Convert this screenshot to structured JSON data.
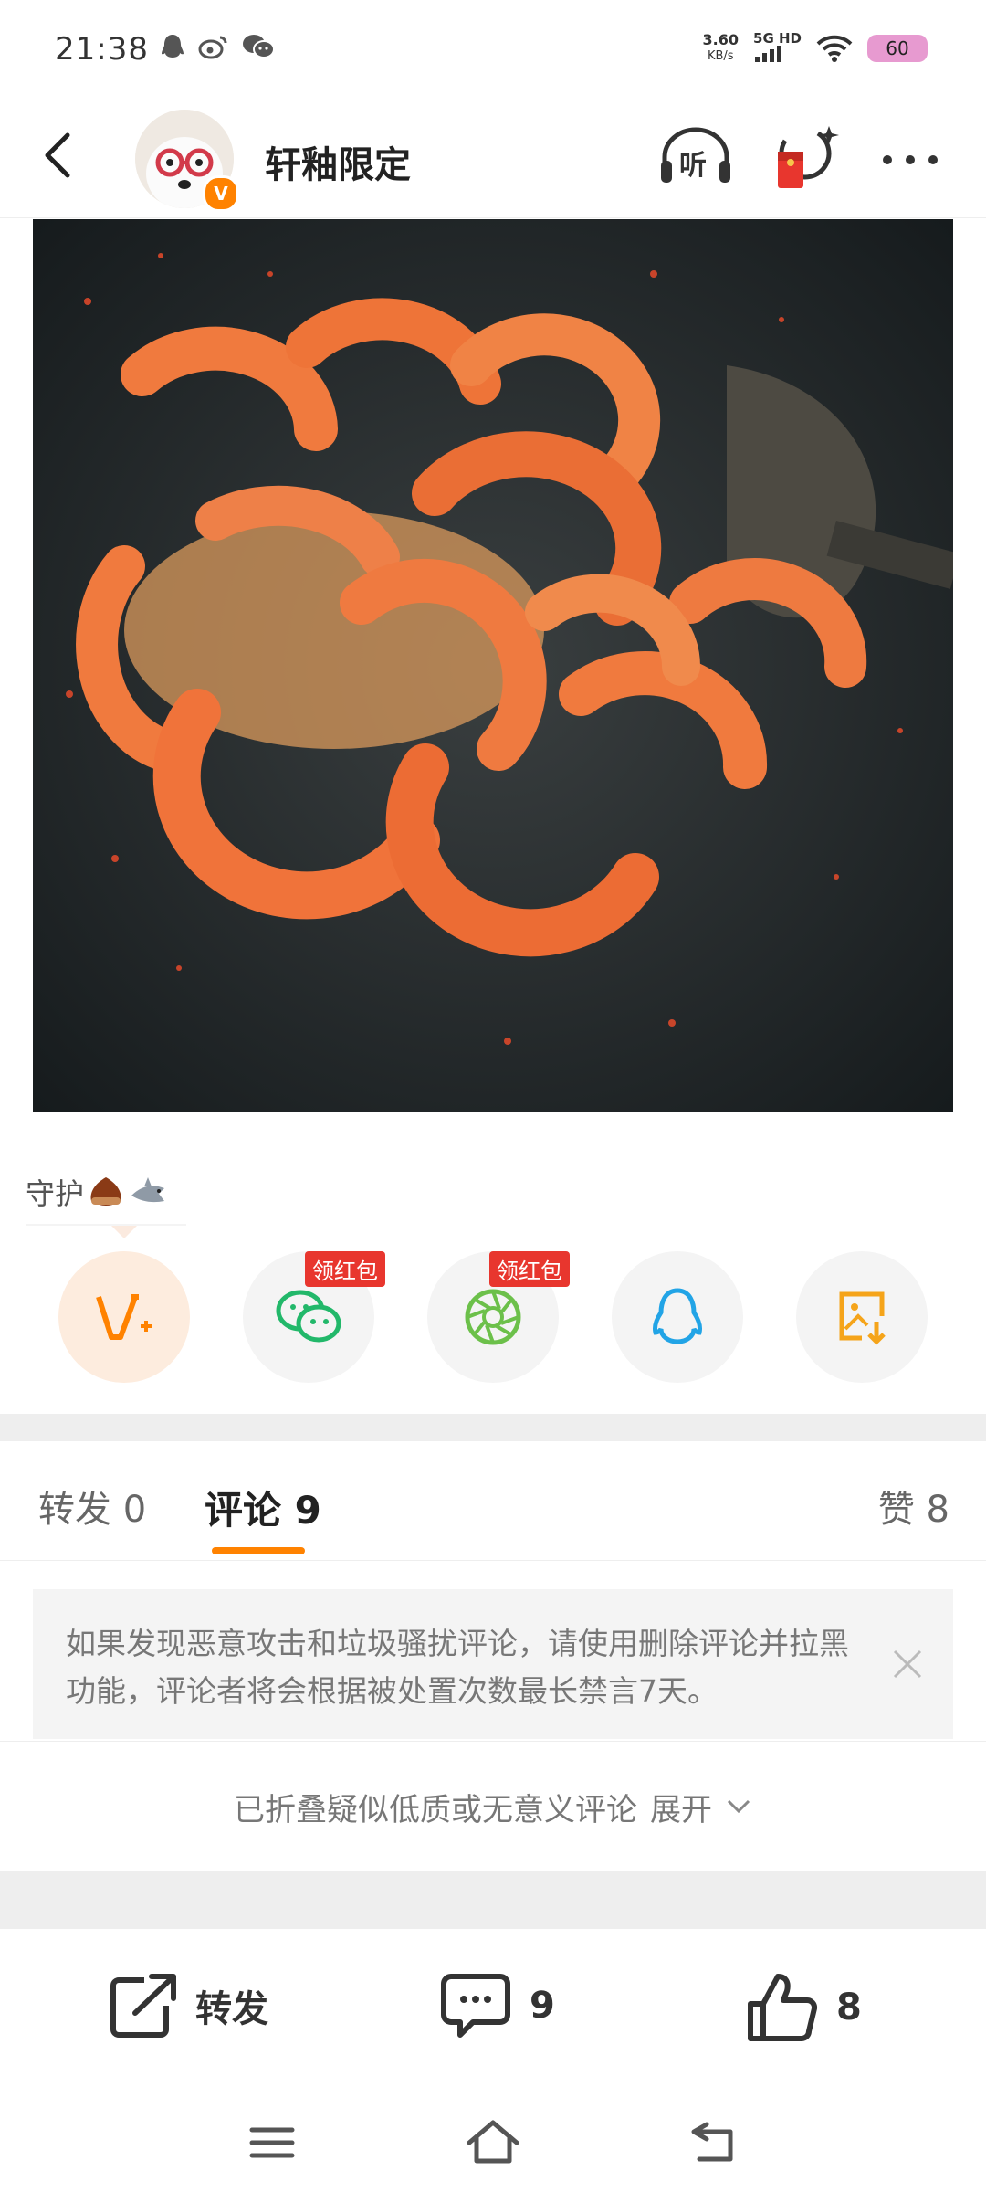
{
  "status_bar": {
    "time": "21:38",
    "net_speed_value": "3.60",
    "net_speed_unit": "KB/s",
    "network": "5G HD",
    "battery": "60"
  },
  "header": {
    "username": "轩釉限定",
    "verified_badge": "V",
    "listen_label": "听"
  },
  "post": {
    "guard_label": "守护"
  },
  "share": {
    "items": [
      {
        "name": "weibo-repost",
        "tag": ""
      },
      {
        "name": "wechat",
        "tag": "领红包"
      },
      {
        "name": "moments",
        "tag": "领红包"
      },
      {
        "name": "qq",
        "tag": ""
      },
      {
        "name": "save-image",
        "tag": ""
      }
    ]
  },
  "tabs": {
    "repost": "转发",
    "repost_count": "0",
    "comment": "评论",
    "comment_count": "9",
    "like": "赞",
    "like_count": "8"
  },
  "notice": {
    "text": "如果发现恶意攻击和垃圾骚扰评论，请使用删除评论并拉黑功能，评论者将会根据被处置次数最长禁言7天。"
  },
  "fold": {
    "text": "已折叠疑似低质或无意义评论",
    "expand": "展开"
  },
  "actions": {
    "repost_label": "转发",
    "comment_count": "9",
    "like_count": "8"
  },
  "colors": {
    "accent": "#ff8200",
    "red_tag": "#e8362e"
  }
}
